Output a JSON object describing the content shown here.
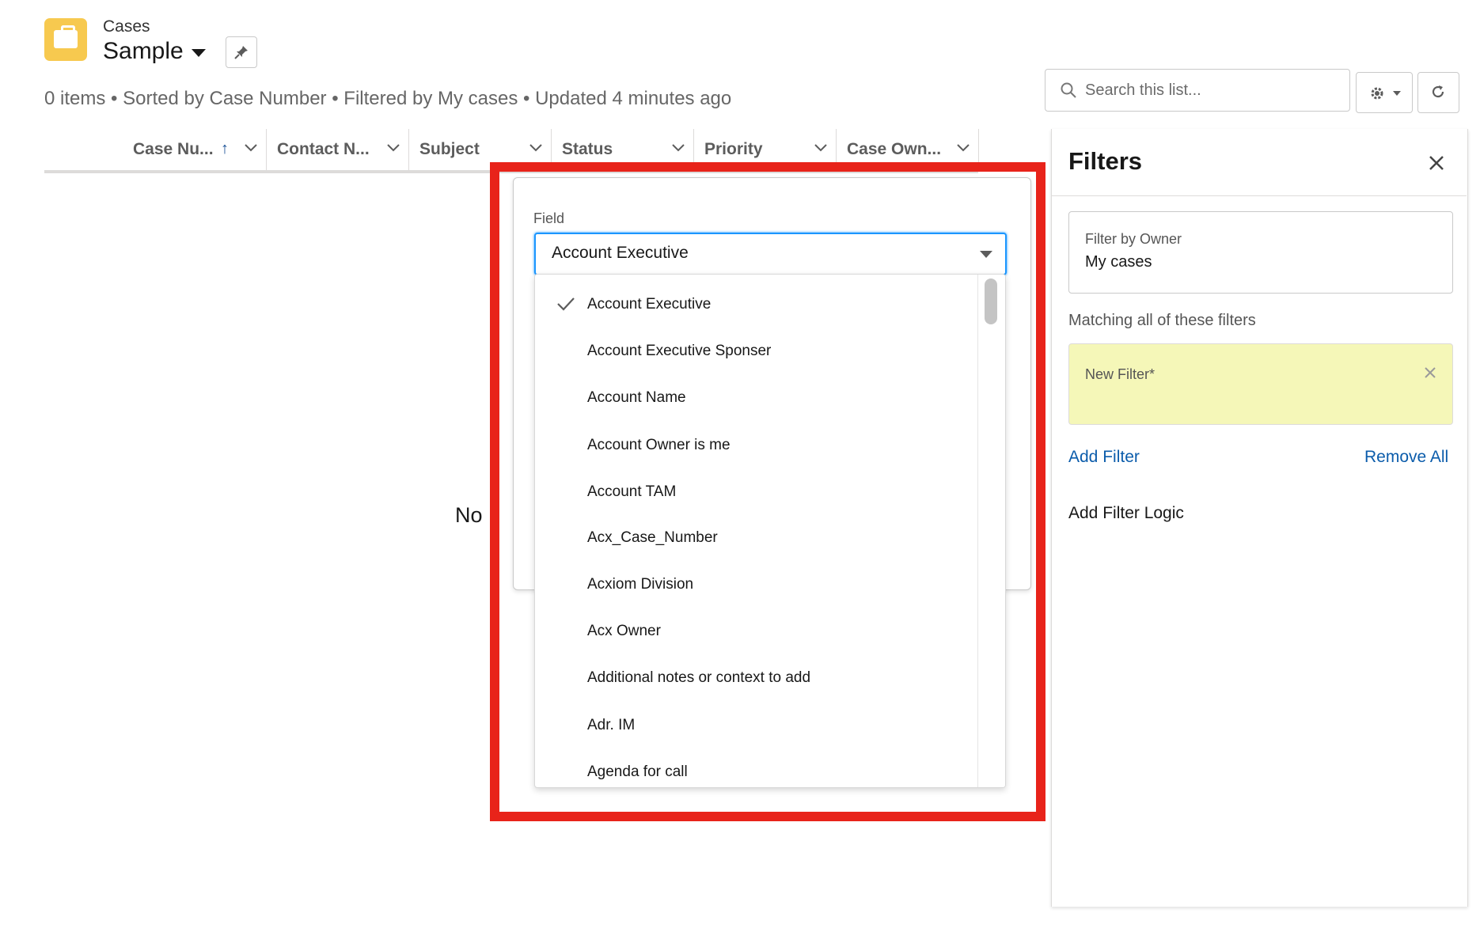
{
  "header": {
    "object_label": "Cases",
    "list_title": "Sample",
    "meta": "0 items • Sorted by Case Number • Filtered by My cases • Updated 4 minutes ago"
  },
  "toolbar": {
    "search_placeholder": "Search this list..."
  },
  "table": {
    "columns": [
      "Case Nu...",
      "Contact N...",
      "Subject",
      "Status",
      "Priority",
      "Case Own..."
    ],
    "sorted_column": "Case Nu...",
    "sort_direction": "ascending",
    "empty_text": "No"
  },
  "filter_popover": {
    "field_label": "Field",
    "selected_value": "Account Executive",
    "options": [
      "Account Executive",
      "Account Executive Sponser",
      "Account Name",
      "Account Owner is me",
      "Account TAM",
      "Acx_Case_Number",
      "Acxiom Division",
      "Acx Owner",
      "Additional notes or context to add",
      "Adr. IM",
      "Agenda for call"
    ]
  },
  "filters_panel": {
    "title": "Filters",
    "owner_caption": "Filter by Owner",
    "owner_value": "My cases",
    "matching_text": "Matching all of these filters",
    "new_filter_label": "New Filter*",
    "add_filter": "Add Filter",
    "remove_all": "Remove All",
    "add_filter_logic": "Add Filter Logic"
  },
  "colors": {
    "brand_icon": "#f7c94f",
    "link": "#0b5cab",
    "focus": "#1b96ff",
    "highlight_box": "#e8231a",
    "new_filter_bg": "#f5f7b8"
  },
  "icons": [
    "briefcase-icon",
    "chevron-down-icon",
    "pin-icon",
    "search-icon",
    "gear-icon",
    "refresh-icon",
    "close-icon",
    "checkmark-icon",
    "sort-up-icon"
  ]
}
